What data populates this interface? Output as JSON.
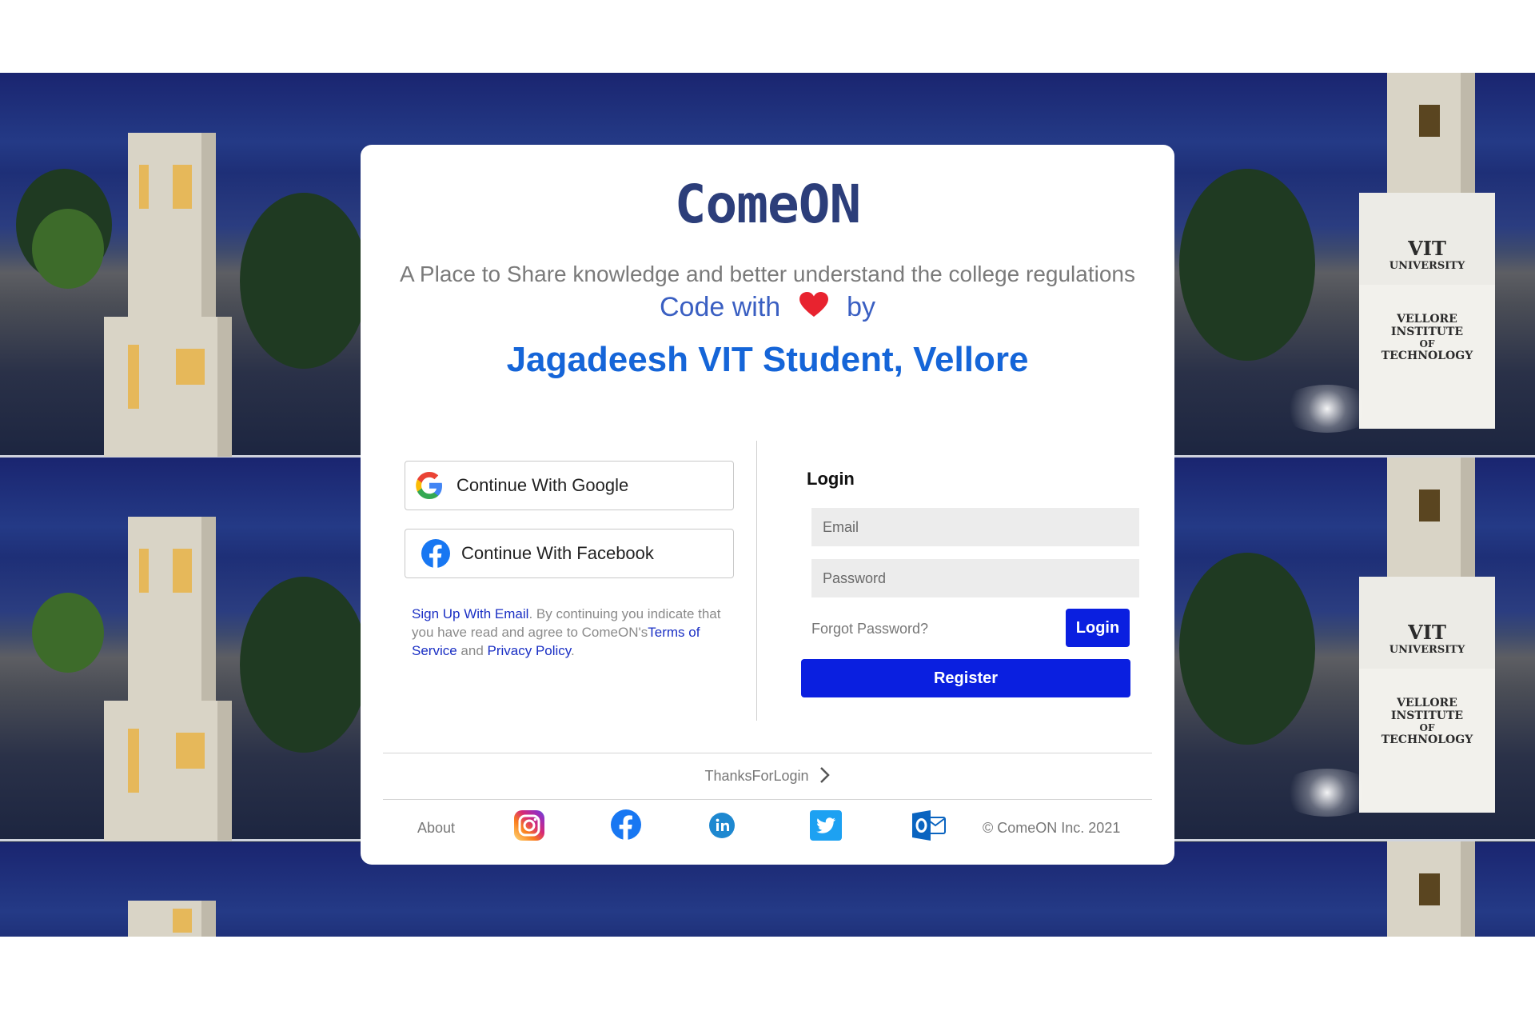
{
  "brand": {
    "name": "ComeON"
  },
  "hero": {
    "tagline": "A Place to Share knowledge and better understand the college regulations",
    "code_with": "Code with",
    "by": "by",
    "author": "Jagadeesh VIT Student, Vellore"
  },
  "background": {
    "sign_line1": "VIT",
    "sign_line2": "UNIVERSITY",
    "plaque_line1": "VELLORE",
    "plaque_line2": "INSTITUTE",
    "plaque_line3": "OF",
    "plaque_line4": "TECHNOLOGY"
  },
  "social": {
    "google_label": "Continue With Google",
    "facebook_label": "Continue With Facebook"
  },
  "legal": {
    "signup_link": "Sign Up With Email",
    "text1": ". By continuing you indicate that you have read and agree to ComeON's",
    "terms_link": "Terms of Service",
    "text2": " and ",
    "privacy_link": "Privacy Policy",
    "text3": "."
  },
  "login": {
    "title": "Login",
    "email_placeholder": "Email",
    "password_placeholder": "Password",
    "forgot": "Forgot Password?",
    "login_button": "Login",
    "register_button": "Register"
  },
  "footer": {
    "thanks": "ThanksForLogin",
    "about": "About",
    "copyright": "© ComeON Inc. 2021",
    "icons": [
      "instagram-icon",
      "facebook-icon",
      "linkedin-icon",
      "twitter-icon",
      "outlook-icon"
    ]
  },
  "colors": {
    "brand": "#2c3e7a",
    "accent_blue": "#1565d8",
    "button_blue": "#0a1fe0",
    "heart": "#e8232f"
  }
}
